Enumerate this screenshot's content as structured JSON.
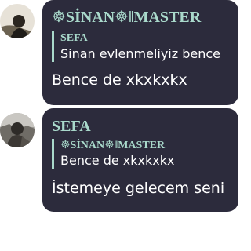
{
  "colors": {
    "bubble_background": "#2c2b3c",
    "name_accent": "#a9d9cb",
    "message_text": "#ffffff",
    "page_background": "#ffffff"
  },
  "messages": [
    {
      "sender": "☸SİNAN☸‖MASTER",
      "avatar_icon": "profile-photo",
      "reply": {
        "sender": "SEFA",
        "text": "Sinan evlenmeliyiz bence"
      },
      "text": "Bence de xkxkxkx"
    },
    {
      "sender": "SEFA",
      "avatar_icon": "profile-photo",
      "reply": {
        "sender": "☸SİNAN☸‖MASTER",
        "text": "Bence de xkxkxkx"
      },
      "text": "İstemeye gelecem seni"
    }
  ]
}
